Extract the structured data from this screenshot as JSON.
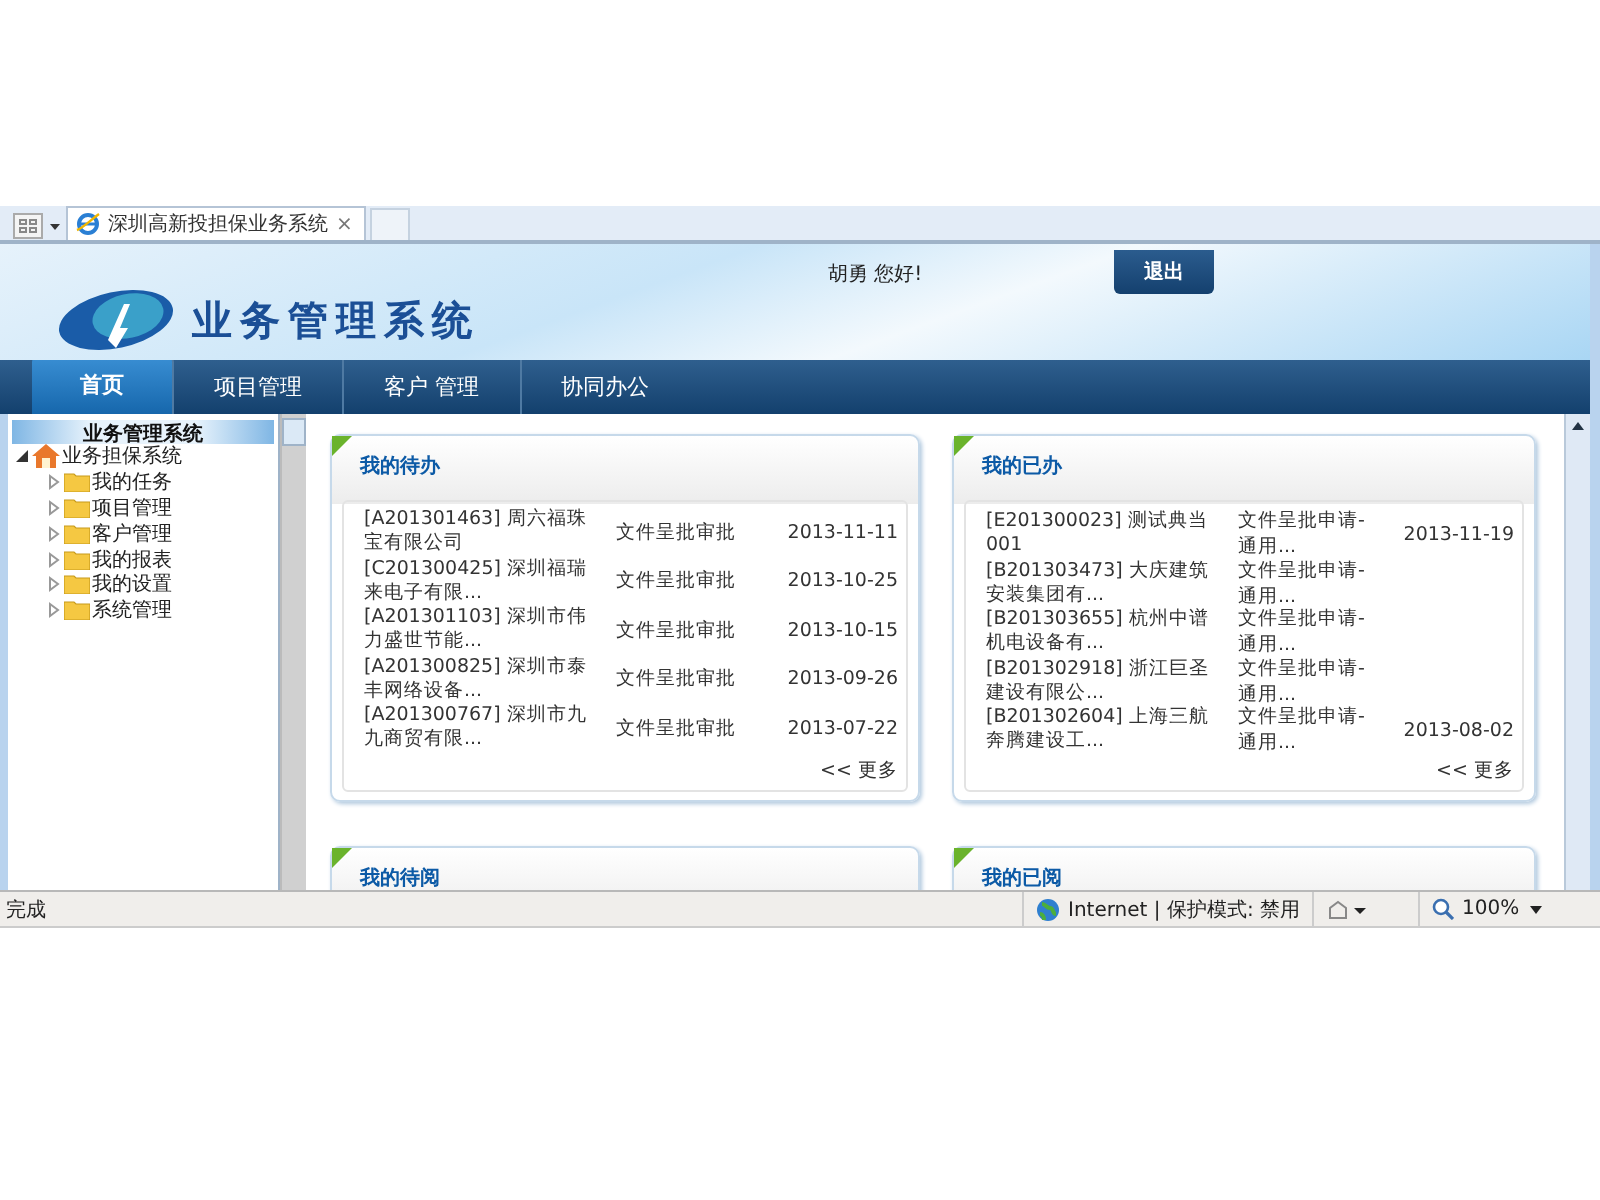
{
  "browser_tab": {
    "title": "深圳高新投担保业务系统",
    "close": "×"
  },
  "header": {
    "system_name": "业务管理系统",
    "greeting": "胡勇 您好!",
    "logout": "退出"
  },
  "nav": [
    {
      "label": "首页",
      "selected": true
    },
    {
      "label": "项目管理",
      "selected": false
    },
    {
      "label": "客户 管理",
      "selected": false
    },
    {
      "label": "协同办公",
      "selected": false
    }
  ],
  "sidebar": {
    "title": "业务管理系统",
    "tree": [
      {
        "label": "业务担保系统",
        "kind": "home",
        "expanded": true,
        "children": [
          {
            "label": "我的任务",
            "kind": "folder",
            "expanded": false
          },
          {
            "label": "项目管理",
            "kind": "folder",
            "expanded": false
          },
          {
            "label": "客户管理",
            "kind": "folder",
            "expanded": false
          },
          {
            "label": "我的报表",
            "kind": "folder",
            "expanded": false
          },
          {
            "label": "我的设置",
            "kind": "folder",
            "expanded": false
          },
          {
            "label": "系统管理",
            "kind": "folder",
            "expanded": false
          }
        ]
      }
    ]
  },
  "panels": [
    {
      "title": "我的待办",
      "more": "<< 更多",
      "rows": [
        {
          "subject": "[A201301463] 周六福珠宝有限公司",
          "type": "文件呈批审批",
          "date": "2013-11-11"
        },
        {
          "subject": "[C201300425] 深圳福瑞来电子有限...",
          "type": "文件呈批审批",
          "date": "2013-10-25"
        },
        {
          "subject": "[A201301103] 深圳市伟力盛世节能...",
          "type": "文件呈批审批",
          "date": "2013-10-15"
        },
        {
          "subject": "[A201300825] 深圳市泰丰网络设备...",
          "type": "文件呈批审批",
          "date": "2013-09-26"
        },
        {
          "subject": "[A201300767] 深圳市九九商贸有限...",
          "type": "文件呈批审批",
          "date": "2013-07-22"
        }
      ]
    },
    {
      "title": "我的已办",
      "more": "<< 更多",
      "rows": [
        {
          "subject": "[E201300023] 测试典当001",
          "type": "文件呈批申请-通用...",
          "date": "2013-11-19"
        },
        {
          "subject": "[B201303473] 大庆建筑安装集团有...",
          "type": "文件呈批申请-通用..."
        },
        {
          "subject": "[B201303655] 杭州中谱机电设备有...",
          "type": "文件呈批申请-通用..."
        },
        {
          "subject": "[B201302918] 浙江巨圣建设有限公...",
          "type": "文件呈批申请-通用..."
        },
        {
          "subject": "[B201302604] 上海三航奔腾建设工...",
          "type": "文件呈批申请-通用...",
          "date": "2013-08-02"
        }
      ]
    },
    {
      "title": "我的待阅"
    },
    {
      "title": "我的已阅"
    }
  ],
  "status_bar": {
    "status": "完成",
    "zone": "Internet | 保护模式: 禁用",
    "zoom": "100%"
  }
}
